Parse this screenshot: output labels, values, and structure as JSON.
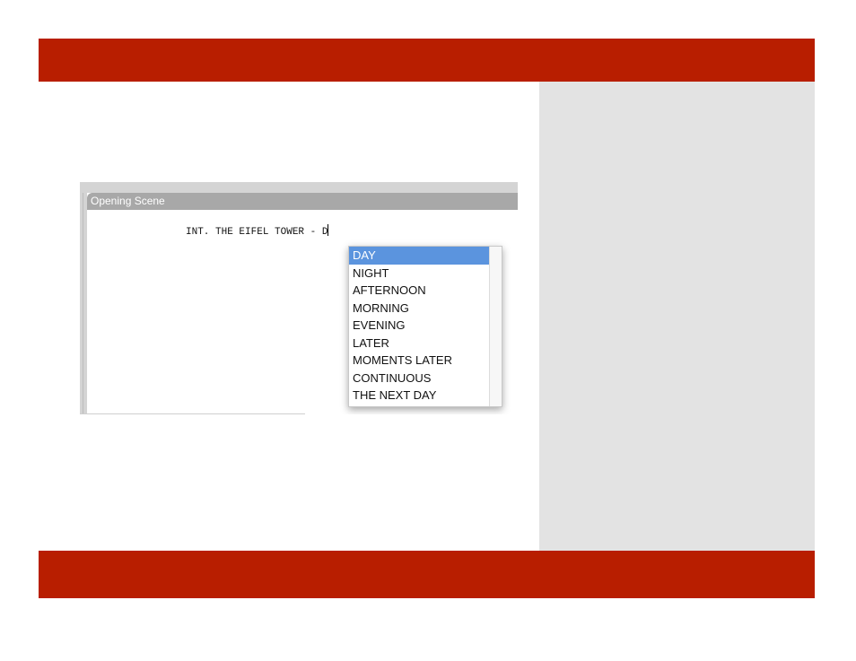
{
  "colors": {
    "accent_bar": "#b81e00",
    "side_panel": "#e3e3e3",
    "selection": "#5b94de"
  },
  "window": {
    "title": "Opening Scene"
  },
  "editor": {
    "line_text": "INT. THE EIFEL TOWER - D"
  },
  "autocomplete": {
    "selected_index": 0,
    "items": [
      "DAY",
      "NIGHT",
      "AFTERNOON",
      "MORNING",
      "EVENING",
      "LATER",
      "MOMENTS LATER",
      "CONTINUOUS",
      "THE NEXT DAY"
    ]
  }
}
